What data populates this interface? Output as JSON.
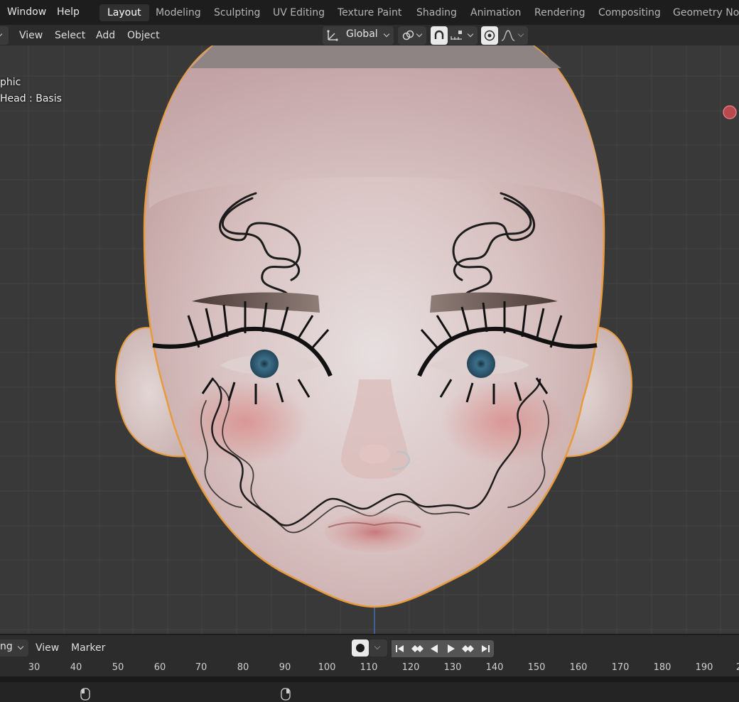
{
  "top_menu": {
    "window": "Window",
    "help": "Help"
  },
  "workspaces": [
    {
      "label": "Layout",
      "active": true
    },
    {
      "label": "Modeling"
    },
    {
      "label": "Sculpting"
    },
    {
      "label": "UV Editing"
    },
    {
      "label": "Texture Paint"
    },
    {
      "label": "Shading"
    },
    {
      "label": "Animation"
    },
    {
      "label": "Rendering"
    },
    {
      "label": "Compositing"
    },
    {
      "label": "Geometry Nod"
    }
  ],
  "viewport_header": {
    "view": "View",
    "select": "Select",
    "add": "Add",
    "object": "Object",
    "transform_orientation": "Global"
  },
  "viewport": {
    "overlay_line1": "phic",
    "overlay_line2": "Head : Basis"
  },
  "timeline": {
    "mode": "ng",
    "view": "View",
    "marker": "Marker",
    "ticks": [
      "30",
      "40",
      "50",
      "60",
      "70",
      "80",
      "90",
      "100",
      "110",
      "120",
      "130",
      "140",
      "150",
      "160",
      "170",
      "180",
      "190",
      "2"
    ],
    "current_frame": 111
  },
  "colors": {
    "accent": "#e89b3c",
    "active_tab": "#303030",
    "playhead": "#4772b3"
  }
}
